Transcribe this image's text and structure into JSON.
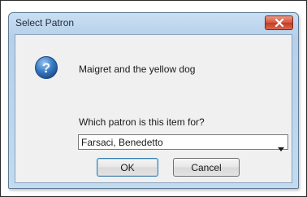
{
  "window": {
    "title": "Select Patron"
  },
  "dialog": {
    "icon": "question-icon",
    "message": "Maigret and the yellow dog",
    "prompt": "Which patron is this item for?",
    "patron_select": {
      "selected": "Farsaci, Benedetto"
    },
    "ok_label": "OK",
    "cancel_label": "Cancel"
  },
  "colors": {
    "close_button": "#d4533a",
    "icon_blue": "#2f6fb8",
    "titlebar": "#c3dbef"
  }
}
